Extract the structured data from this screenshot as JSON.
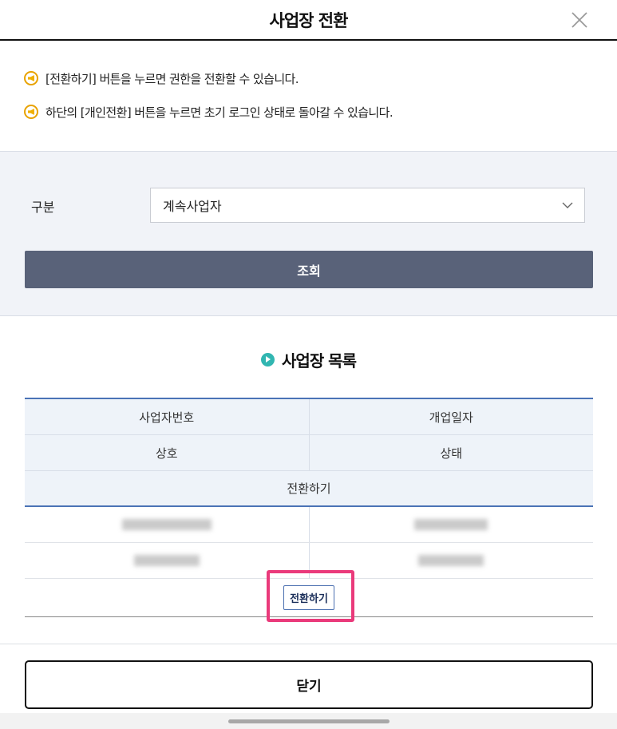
{
  "header": {
    "title": "사업장 전환",
    "close_icon": "close-icon"
  },
  "notice": {
    "icon": "speaker-notice-icon",
    "lines": [
      "[전환하기] 버튼을 누르면 권한을 전환할 수 있습니다.",
      "하단의 [개인전환] 버튼을 누르면 초기 로그인 상태로 돌아갈 수 있습니다."
    ]
  },
  "search": {
    "label": "구분",
    "selected": "계속사업자",
    "button_label": "조회"
  },
  "section": {
    "title": "사업장 목록",
    "icon": "play-circle-icon"
  },
  "table": {
    "headers": {
      "business_number": "사업자번호",
      "open_date": "개업일자",
      "company_name": "상호",
      "status": "상태",
      "switch": "전환하기"
    },
    "rows": [
      {
        "switch_label": "전환하기"
      }
    ]
  },
  "footer": {
    "close_label": "닫기"
  },
  "colors": {
    "accent_blue": "#4b73b6",
    "search_button": "#596279",
    "highlight": "#ea3a7b",
    "notice_icon": "#f0b000",
    "section_icon": "#31b6b1"
  }
}
